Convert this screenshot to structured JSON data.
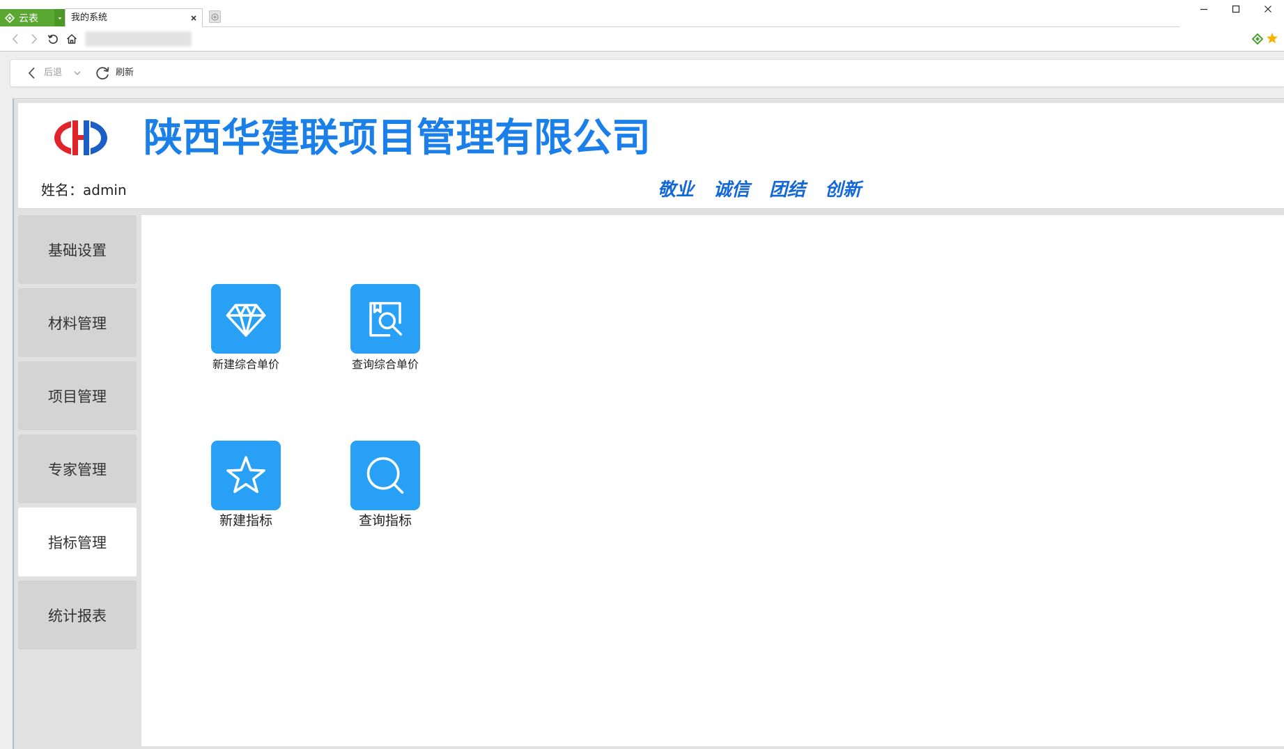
{
  "browser": {
    "app_button": {
      "label": "云表",
      "icon": "app-diamond-icon"
    },
    "tab": {
      "title": "我的系统",
      "close_icon": "close-tab-icon"
    },
    "nav_icons": [
      "back-icon",
      "forward-icon",
      "reload-icon",
      "home-icon"
    ],
    "window_controls": [
      "minimize-icon",
      "maximize-icon",
      "close-icon"
    ],
    "extension_icons": [
      "green-diamond-icon",
      "favorite-star-icon"
    ]
  },
  "toolbar": {
    "back_label": "后退",
    "refresh_label": "刷新"
  },
  "header": {
    "logo_icon": "company-logo-icon",
    "company_name": "陕西华建联项目管理有限公司",
    "user_label": "姓名：admin",
    "slogan": [
      "敬业",
      "诚信",
      "团结",
      "创新"
    ]
  },
  "sidebar": {
    "items": [
      {
        "label": "基础设置",
        "active": false
      },
      {
        "label": "材料管理",
        "active": false
      },
      {
        "label": "项目管理",
        "active": false
      },
      {
        "label": "专家管理",
        "active": false
      },
      {
        "label": "指标管理",
        "active": true
      },
      {
        "label": "统计报表",
        "active": false
      }
    ]
  },
  "tiles": [
    {
      "label": "新建综合单价",
      "icon": "diamond-icon"
    },
    {
      "label": "查询综合单价",
      "icon": "document-search-icon"
    },
    {
      "label": "新建指标",
      "icon": "star-icon"
    },
    {
      "label": "查询指标",
      "icon": "search-icon"
    }
  ],
  "colors": {
    "app_button": "#5aa832",
    "title_blue": "#1a7fe8",
    "slogan_blue": "#1467d6",
    "tile_blue": "#27a0f6",
    "logo_red": "#e1232b",
    "logo_blue": "#1b5fc6",
    "sidebar_item": "#d4d4d4",
    "sidebar_item_active": "#ffffff"
  }
}
